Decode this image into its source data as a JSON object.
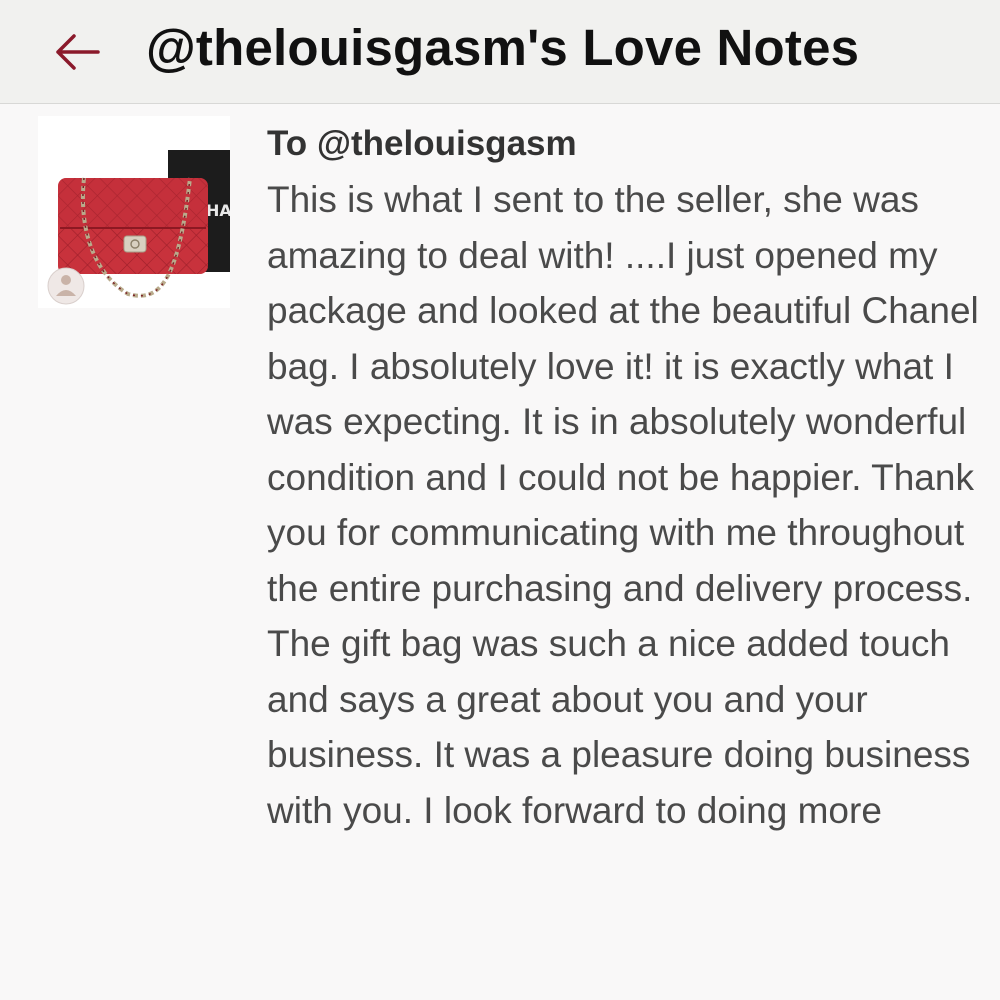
{
  "header": {
    "back_icon": "arrow-left-icon",
    "title": "@thelouisgasm's Love Notes",
    "accent_color": "#8b1a2b"
  },
  "note": {
    "recipient": "To @thelouisgasm",
    "listing_image": {
      "description_icon": "red-quilted-handbag-image",
      "box_text": "HA"
    },
    "message": "This is what I sent to the seller, she was amazing to deal with! ....I just opened my package and looked at the beautiful Chanel bag. I absolutely love it! it is exactly what I was expecting. It is in absolutely wonderful condition and I could not be happier. Thank you for communicating with me throughout the entire purchasing and delivery process. The gift bag was such a nice added touch and says a great about you and your business. It was a pleasure doing business with you. I look forward to doing more"
  }
}
